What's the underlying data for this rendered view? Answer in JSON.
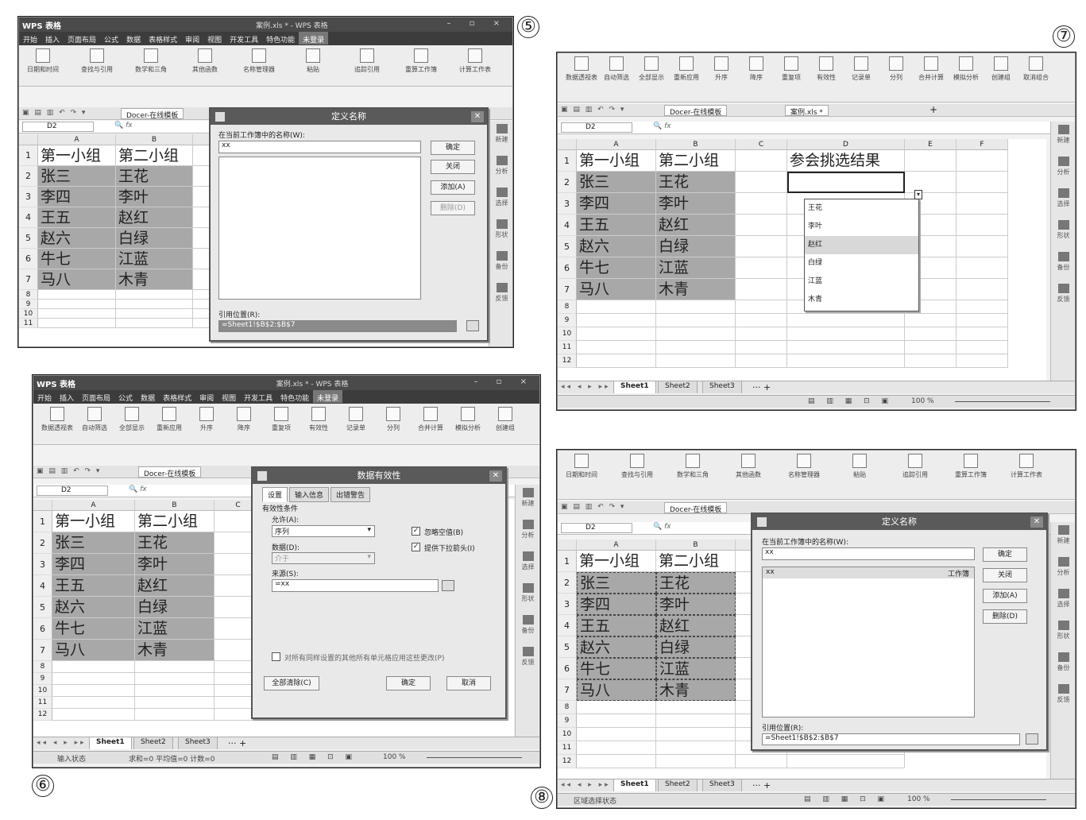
{
  "app": {
    "title": "WPS 表格",
    "doc_title": "案例.xls * - WPS 表格",
    "menus": [
      "开始",
      "插入",
      "页面布局",
      "公式",
      "数据",
      "表格样式",
      "审阅",
      "视图",
      "开发工具",
      "特色功能",
      "未登录"
    ],
    "doc_tab": "Docer-在线模板",
    "doc_tab2": "案例.xls *",
    "name_box": "D2",
    "fx": "fx"
  },
  "ribbon_formula": [
    "日期和时间",
    "查找与引用",
    "数学和三角",
    "其他函数",
    "名称管理器",
    "粘贴",
    "追踪引用",
    "重算工作簿",
    "计算工作表"
  ],
  "ribbon_data": [
    "数据透视表",
    "自动筛选",
    "全部显示",
    "重新应用",
    "升序",
    "降序",
    "重复项",
    "有效性",
    "记录单",
    "分列",
    "合并计算",
    "模拟分析",
    "创建组",
    "取消组合"
  ],
  "headers": {
    "A": "A",
    "B": "B",
    "C": "C",
    "D": "D",
    "E": "E",
    "F": "F"
  },
  "table": {
    "col_a_header": "第一小组",
    "col_b_header": "第二小组",
    "col_a": [
      "张三",
      "李四",
      "王五",
      "赵六",
      "牛七",
      "马八"
    ],
    "col_b": [
      "王花",
      "李叶",
      "赵红",
      "白绿",
      "江蓝",
      "木青"
    ],
    "rows": [
      "1",
      "2",
      "3",
      "4",
      "5",
      "6",
      "7",
      "8",
      "9",
      "10",
      "11",
      "12"
    ]
  },
  "panel5": {
    "number": "⑤",
    "dialog_title": "定义名称",
    "name_label": "在当前工作簿中的名称(W):",
    "name_value": "xx",
    "ok": "确定",
    "close": "关闭",
    "add": "添加(A)",
    "delete": "删除(D)",
    "ref_label": "引用位置(R):",
    "ref_value": "=Sheet1!$B$2:$B$7"
  },
  "panel6": {
    "number": "⑥",
    "dialog_title": "数据有效性",
    "tabs": [
      "设置",
      "输入信息",
      "出错警告"
    ],
    "criteria": "有效性条件",
    "allow_label": "允许(A):",
    "allow_value": "序列",
    "data_label": "数据(D):",
    "data_value": "介于",
    "ignore_blank": "忽略空值(B)",
    "dropdown_arrow": "提供下拉箭头(I)",
    "source_label": "来源(S):",
    "source_value": "=xx",
    "apply_all": "对所有同样设置的其他所有单元格应用这些更改(P)",
    "clear_all": "全部清除(C)",
    "ok": "确定",
    "cancel": "取消",
    "status": "输入状态",
    "status_calc": "求和=0  平均值=0  计数=0",
    "zoom": "100 %"
  },
  "panel7": {
    "number": "⑦",
    "d1": "参会挑选结果",
    "dropdown": [
      "王花",
      "李叶",
      "赵红",
      "白绿",
      "江蓝",
      "木青"
    ],
    "selected": "赵红",
    "zoom": "100 %"
  },
  "panel8": {
    "number": "⑧",
    "dialog_title": "定义名称",
    "name_label": "在当前工作簿中的名称(W):",
    "name_value": "xx",
    "list_name": "xx",
    "list_scope": "工作簿",
    "ok": "确定",
    "close": "关闭",
    "add": "添加(A)",
    "delete": "删除(D)",
    "ref_label": "引用位置(R):",
    "ref_value": "=Sheet1!$B$2:$B$7",
    "status": "区域选择状态",
    "zoom": "100 %"
  },
  "sheets": [
    "Sheet1",
    "Sheet2",
    "Sheet3"
  ],
  "side_labels": [
    "新建",
    "分析",
    "选择",
    "形状",
    "备份",
    "反馈"
  ]
}
